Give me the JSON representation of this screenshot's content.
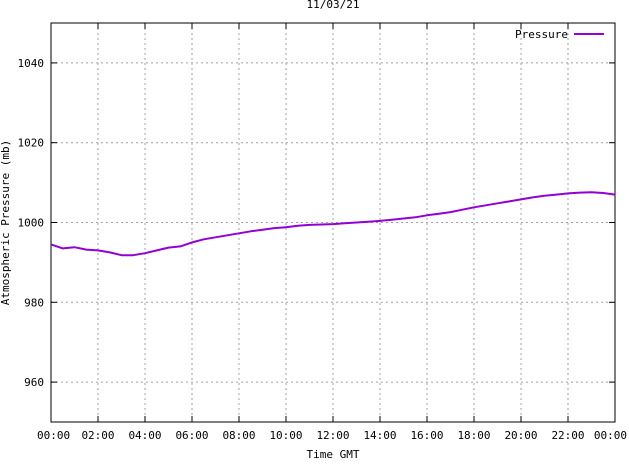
{
  "chart_data": {
    "type": "line",
    "title": "11/03/21",
    "xlabel": "Time GMT",
    "ylabel": "Atmospheric Pressure (mb)",
    "x_tick_labels": [
      "00:00",
      "02:00",
      "04:00",
      "06:00",
      "08:00",
      "10:00",
      "12:00",
      "14:00",
      "16:00",
      "18:00",
      "20:00",
      "22:00",
      "00:00"
    ],
    "xlim_hours": [
      0,
      24
    ],
    "y_ticks": [
      960,
      980,
      1000,
      1020,
      1040
    ],
    "ylim": [
      950,
      1050
    ],
    "grid": true,
    "legend_position": "top-right",
    "series": [
      {
        "name": "Pressure",
        "color": "#9400d3",
        "x_hours": [
          0,
          0.5,
          1,
          1.5,
          2,
          2.5,
          3,
          3.5,
          4,
          4.5,
          5,
          5.5,
          6,
          6.5,
          7,
          7.5,
          8,
          8.5,
          9,
          9.5,
          10,
          10.5,
          11,
          11.5,
          12,
          12.5,
          13,
          13.5,
          14,
          14.5,
          15,
          15.5,
          16,
          16.5,
          17,
          17.5,
          18,
          18.5,
          19,
          19.5,
          20,
          20.5,
          21,
          21.5,
          22,
          22.5,
          23,
          23.5,
          24
        ],
        "values": [
          994.5,
          993.5,
          993.8,
          993.2,
          993.0,
          992.5,
          991.8,
          991.8,
          992.3,
          993.0,
          993.7,
          994.0,
          995.0,
          995.8,
          996.3,
          996.8,
          997.3,
          997.8,
          998.2,
          998.6,
          998.8,
          999.2,
          999.4,
          999.5,
          999.6,
          999.8,
          1000.0,
          1000.2,
          1000.4,
          1000.7,
          1001.0,
          1001.3,
          1001.8,
          1002.2,
          1002.6,
          1003.2,
          1003.8,
          1004.3,
          1004.8,
          1005.3,
          1005.8,
          1006.3,
          1006.7,
          1007.0,
          1007.3,
          1007.5,
          1007.6,
          1007.4,
          1007.0
        ]
      }
    ]
  }
}
